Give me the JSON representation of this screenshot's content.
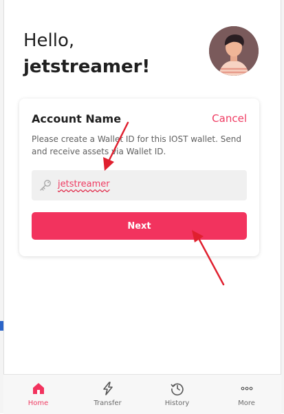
{
  "greeting": {
    "hello": "Hello,",
    "name": "jetstreamer!"
  },
  "card": {
    "title": "Account Name",
    "cancel_label": "Cancel",
    "description": "Please create a Wallet ID for this IOST wallet. Send and receive assets via Wallet ID.",
    "input_value": "jetstreamer",
    "next_label": "Next"
  },
  "nav": {
    "items": [
      {
        "label": "Home",
        "icon": "home-icon",
        "active": true
      },
      {
        "label": "Transfer",
        "icon": "lightning-icon",
        "active": false
      },
      {
        "label": "History",
        "icon": "history-icon",
        "active": false
      },
      {
        "label": "More",
        "icon": "more-dots-icon",
        "active": false
      }
    ]
  },
  "colors": {
    "accent": "#f2335e",
    "accent_text": "#ef3b62",
    "annotation_arrow": "#e0202f"
  }
}
